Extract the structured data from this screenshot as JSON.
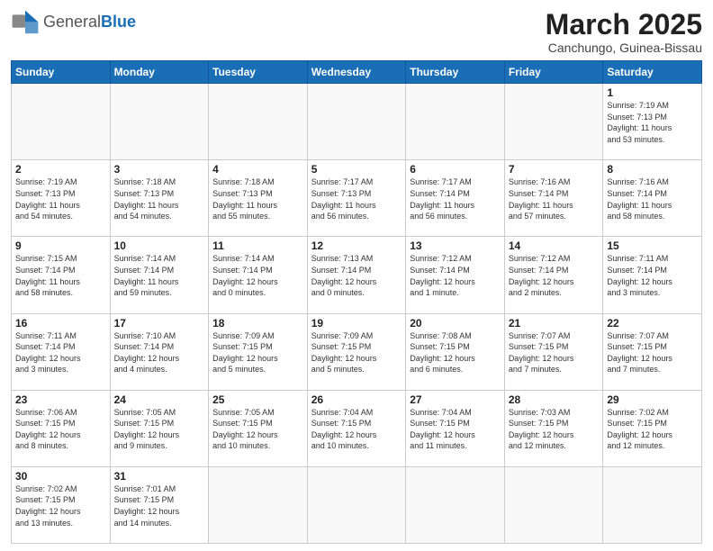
{
  "header": {
    "logo_general": "General",
    "logo_blue": "Blue",
    "title": "March 2025",
    "subtitle": "Canchungo, Guinea-Bissau"
  },
  "weekdays": [
    "Sunday",
    "Monday",
    "Tuesday",
    "Wednesday",
    "Thursday",
    "Friday",
    "Saturday"
  ],
  "weeks": [
    [
      {
        "day": "",
        "info": ""
      },
      {
        "day": "",
        "info": ""
      },
      {
        "day": "",
        "info": ""
      },
      {
        "day": "",
        "info": ""
      },
      {
        "day": "",
        "info": ""
      },
      {
        "day": "",
        "info": ""
      },
      {
        "day": "1",
        "info": "Sunrise: 7:19 AM\nSunset: 7:13 PM\nDaylight: 11 hours\nand 53 minutes."
      }
    ],
    [
      {
        "day": "2",
        "info": "Sunrise: 7:19 AM\nSunset: 7:13 PM\nDaylight: 11 hours\nand 54 minutes."
      },
      {
        "day": "3",
        "info": "Sunrise: 7:18 AM\nSunset: 7:13 PM\nDaylight: 11 hours\nand 54 minutes."
      },
      {
        "day": "4",
        "info": "Sunrise: 7:18 AM\nSunset: 7:13 PM\nDaylight: 11 hours\nand 55 minutes."
      },
      {
        "day": "5",
        "info": "Sunrise: 7:17 AM\nSunset: 7:13 PM\nDaylight: 11 hours\nand 56 minutes."
      },
      {
        "day": "6",
        "info": "Sunrise: 7:17 AM\nSunset: 7:14 PM\nDaylight: 11 hours\nand 56 minutes."
      },
      {
        "day": "7",
        "info": "Sunrise: 7:16 AM\nSunset: 7:14 PM\nDaylight: 11 hours\nand 57 minutes."
      },
      {
        "day": "8",
        "info": "Sunrise: 7:16 AM\nSunset: 7:14 PM\nDaylight: 11 hours\nand 58 minutes."
      }
    ],
    [
      {
        "day": "9",
        "info": "Sunrise: 7:15 AM\nSunset: 7:14 PM\nDaylight: 11 hours\nand 58 minutes."
      },
      {
        "day": "10",
        "info": "Sunrise: 7:14 AM\nSunset: 7:14 PM\nDaylight: 11 hours\nand 59 minutes."
      },
      {
        "day": "11",
        "info": "Sunrise: 7:14 AM\nSunset: 7:14 PM\nDaylight: 12 hours\nand 0 minutes."
      },
      {
        "day": "12",
        "info": "Sunrise: 7:13 AM\nSunset: 7:14 PM\nDaylight: 12 hours\nand 0 minutes."
      },
      {
        "day": "13",
        "info": "Sunrise: 7:12 AM\nSunset: 7:14 PM\nDaylight: 12 hours\nand 1 minute."
      },
      {
        "day": "14",
        "info": "Sunrise: 7:12 AM\nSunset: 7:14 PM\nDaylight: 12 hours\nand 2 minutes."
      },
      {
        "day": "15",
        "info": "Sunrise: 7:11 AM\nSunset: 7:14 PM\nDaylight: 12 hours\nand 3 minutes."
      }
    ],
    [
      {
        "day": "16",
        "info": "Sunrise: 7:11 AM\nSunset: 7:14 PM\nDaylight: 12 hours\nand 3 minutes."
      },
      {
        "day": "17",
        "info": "Sunrise: 7:10 AM\nSunset: 7:14 PM\nDaylight: 12 hours\nand 4 minutes."
      },
      {
        "day": "18",
        "info": "Sunrise: 7:09 AM\nSunset: 7:15 PM\nDaylight: 12 hours\nand 5 minutes."
      },
      {
        "day": "19",
        "info": "Sunrise: 7:09 AM\nSunset: 7:15 PM\nDaylight: 12 hours\nand 5 minutes."
      },
      {
        "day": "20",
        "info": "Sunrise: 7:08 AM\nSunset: 7:15 PM\nDaylight: 12 hours\nand 6 minutes."
      },
      {
        "day": "21",
        "info": "Sunrise: 7:07 AM\nSunset: 7:15 PM\nDaylight: 12 hours\nand 7 minutes."
      },
      {
        "day": "22",
        "info": "Sunrise: 7:07 AM\nSunset: 7:15 PM\nDaylight: 12 hours\nand 7 minutes."
      }
    ],
    [
      {
        "day": "23",
        "info": "Sunrise: 7:06 AM\nSunset: 7:15 PM\nDaylight: 12 hours\nand 8 minutes."
      },
      {
        "day": "24",
        "info": "Sunrise: 7:05 AM\nSunset: 7:15 PM\nDaylight: 12 hours\nand 9 minutes."
      },
      {
        "day": "25",
        "info": "Sunrise: 7:05 AM\nSunset: 7:15 PM\nDaylight: 12 hours\nand 10 minutes."
      },
      {
        "day": "26",
        "info": "Sunrise: 7:04 AM\nSunset: 7:15 PM\nDaylight: 12 hours\nand 10 minutes."
      },
      {
        "day": "27",
        "info": "Sunrise: 7:04 AM\nSunset: 7:15 PM\nDaylight: 12 hours\nand 11 minutes."
      },
      {
        "day": "28",
        "info": "Sunrise: 7:03 AM\nSunset: 7:15 PM\nDaylight: 12 hours\nand 12 minutes."
      },
      {
        "day": "29",
        "info": "Sunrise: 7:02 AM\nSunset: 7:15 PM\nDaylight: 12 hours\nand 12 minutes."
      }
    ],
    [
      {
        "day": "30",
        "info": "Sunrise: 7:02 AM\nSunset: 7:15 PM\nDaylight: 12 hours\nand 13 minutes."
      },
      {
        "day": "31",
        "info": "Sunrise: 7:01 AM\nSunset: 7:15 PM\nDaylight: 12 hours\nand 14 minutes."
      },
      {
        "day": "",
        "info": ""
      },
      {
        "day": "",
        "info": ""
      },
      {
        "day": "",
        "info": ""
      },
      {
        "day": "",
        "info": ""
      },
      {
        "day": "",
        "info": ""
      }
    ]
  ]
}
